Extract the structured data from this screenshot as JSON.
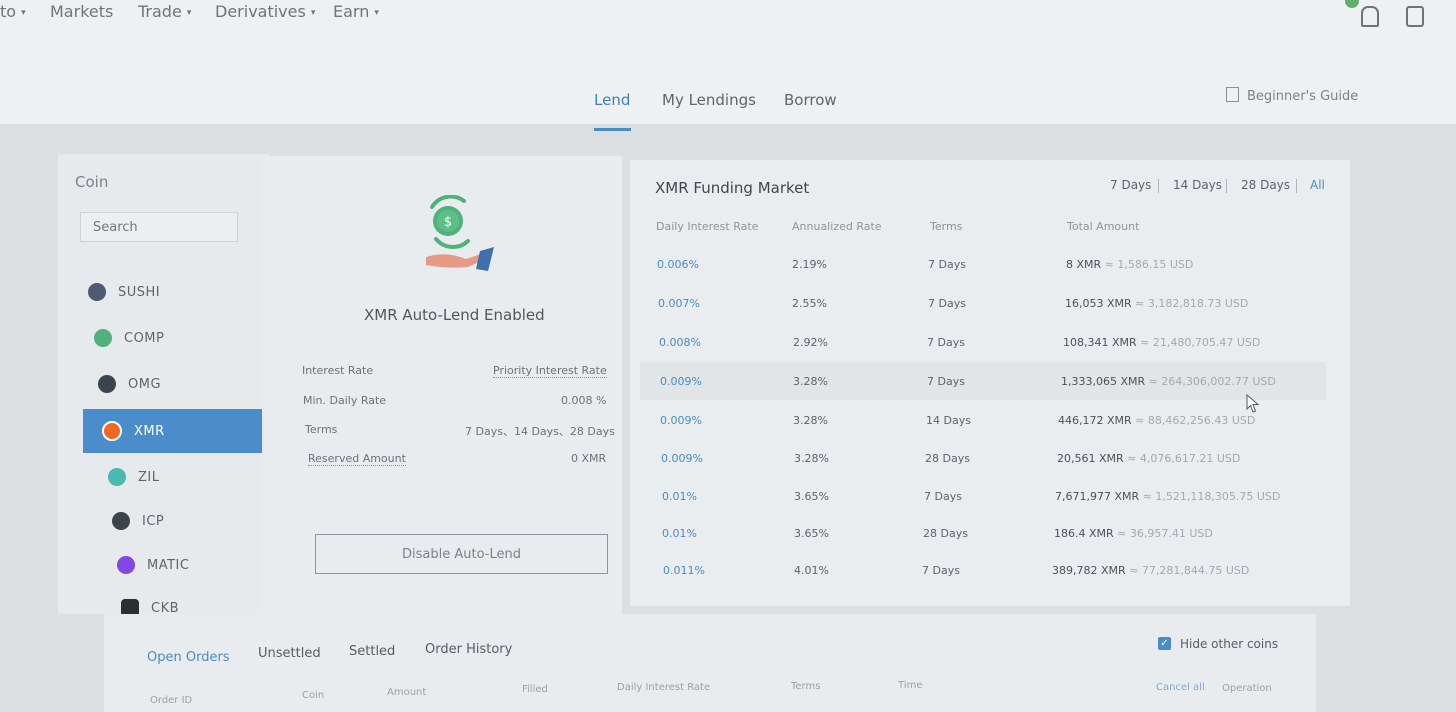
{
  "topnav": {
    "items": [
      {
        "label": "to",
        "caret": "▾"
      },
      {
        "label": "Markets",
        "caret": ""
      },
      {
        "label": "Trade",
        "caret": "▾"
      },
      {
        "label": "Derivatives",
        "caret": "▾"
      },
      {
        "label": "Earn",
        "caret": "▾"
      }
    ]
  },
  "tabs": [
    {
      "label": "Lend"
    },
    {
      "label": "My Lendings"
    },
    {
      "label": "Borrow"
    }
  ],
  "guide_label": "Beginner's Guide",
  "coin_panel": {
    "title": "Coin",
    "search_placeholder": "Search",
    "coins": [
      {
        "label": "SUSHI",
        "color": "#4e5a72"
      },
      {
        "label": "COMP",
        "color": "#4fb27a"
      },
      {
        "label": "OMG",
        "color": "#3b4550"
      },
      {
        "label": "XMR",
        "color": "#f26822"
      },
      {
        "label": "ZIL",
        "color": "#49b9b1"
      },
      {
        "label": "ICP",
        "color": "#3d434a"
      },
      {
        "label": "MATIC",
        "color": "#8247e5"
      },
      {
        "label": "CKB",
        "color": "#2b2f33"
      }
    ],
    "selected": "XMR"
  },
  "auto_lend": {
    "title": "XMR Auto-Lend Enabled",
    "interest_rate_label": "Interest Rate",
    "interest_rate_value": "Priority Interest Rate",
    "min_daily_rate_label": "Min. Daily Rate",
    "min_daily_rate_value": "0.008 %",
    "terms_label": "Terms",
    "terms_value": "7 Days、14 Days、28 Days",
    "reserved_amount_label": "Reserved Amount",
    "reserved_amount_value": "0 XMR",
    "disable_button": "Disable Auto-Lend"
  },
  "market": {
    "title": "XMR Funding Market",
    "filters": [
      "7 Days",
      "14 Days",
      "28 Days",
      "All"
    ],
    "active_filter": "All",
    "columns": [
      "Daily Interest Rate",
      "Annualized Rate",
      "Terms",
      "Total Amount"
    ],
    "rows": [
      {
        "rate": "0.006%",
        "annual": "2.19%",
        "terms": "7 Days",
        "amount": "8 XMR",
        "usd": " ≈ 1,586.15 USD"
      },
      {
        "rate": "0.007%",
        "annual": "2.55%",
        "terms": "7 Days",
        "amount": "16,053 XMR",
        "usd": " ≈ 3,182,818.73 USD"
      },
      {
        "rate": "0.008%",
        "annual": "2.92%",
        "terms": "7 Days",
        "amount": "108,341 XMR",
        "usd": " ≈ 21,480,705.47 USD"
      },
      {
        "rate": "0.009%",
        "annual": "3.28%",
        "terms": "7 Days",
        "amount": "1,333,065 XMR",
        "usd": " ≈ 264,306,002.77 USD"
      },
      {
        "rate": "0.009%",
        "annual": "3.28%",
        "terms": "14 Days",
        "amount": "446,172 XMR",
        "usd": " ≈ 88,462,256.43 USD"
      },
      {
        "rate": "0.009%",
        "annual": "3.28%",
        "terms": "28 Days",
        "amount": "20,561 XMR",
        "usd": " ≈ 4,076,617.21 USD"
      },
      {
        "rate": "0.01%",
        "annual": "3.65%",
        "terms": "7 Days",
        "amount": "7,671,977 XMR",
        "usd": " ≈ 1,521,118,305.75 USD"
      },
      {
        "rate": "0.01%",
        "annual": "3.65%",
        "terms": "28 Days",
        "amount": "186.4 XMR",
        "usd": " ≈ 36,957.41 USD"
      },
      {
        "rate": "0.011%",
        "annual": "4.01%",
        "terms": "7 Days",
        "amount": "389,782 XMR",
        "usd": " ≈ 77,281,844.75 USD"
      }
    ]
  },
  "orders": {
    "tabs": [
      "Open Orders",
      "Unsettled",
      "Settled",
      "Order History"
    ],
    "hide_other_coins": "Hide other coins",
    "hide_checked": true,
    "columns": [
      "Order ID",
      "Coin",
      "Amount",
      "Filled",
      "Daily Interest Rate",
      "Terms",
      "Time",
      "Cancel all",
      "Operation"
    ]
  },
  "colors": {
    "accent": "#4a8cc4",
    "selected_bg": "#4b8dcb"
  },
  "icons": {
    "lend_illustration": "hand-coin-icon",
    "guide": "book-icon",
    "bell": "bell-icon",
    "orders": "document-icon"
  }
}
